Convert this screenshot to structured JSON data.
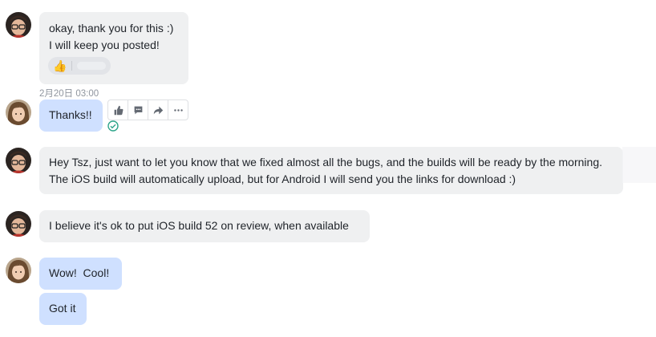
{
  "messages": {
    "m1": {
      "lines": [
        "okay, thank you for this :)",
        "I will keep you posted!"
      ]
    },
    "timestamp": "2月20日 03:00",
    "m2": {
      "text": "Thanks!!"
    },
    "m3": {
      "text": "Hey Tsz, just want to let you know that we fixed almost all the bugs, and the builds will be ready by the morning. The iOS build will automatically upload, but for Android I will send you the links for download :)"
    },
    "m4": {
      "text": "I believe it's ok to put iOS build 52 on review, when available"
    },
    "m5": {
      "text": "Wow!  Cool!"
    },
    "m6": {
      "text": "Got it"
    }
  },
  "reaction": {
    "emoji": "👍"
  },
  "toolbar_icons": [
    "thumbs-up-icon",
    "reply-icon",
    "forward-icon",
    "more-icon"
  ],
  "colors": {
    "gray_bubble": "#eff0f1",
    "blue_bubble": "#cfe0ff",
    "read_check": "#2ea58a"
  }
}
